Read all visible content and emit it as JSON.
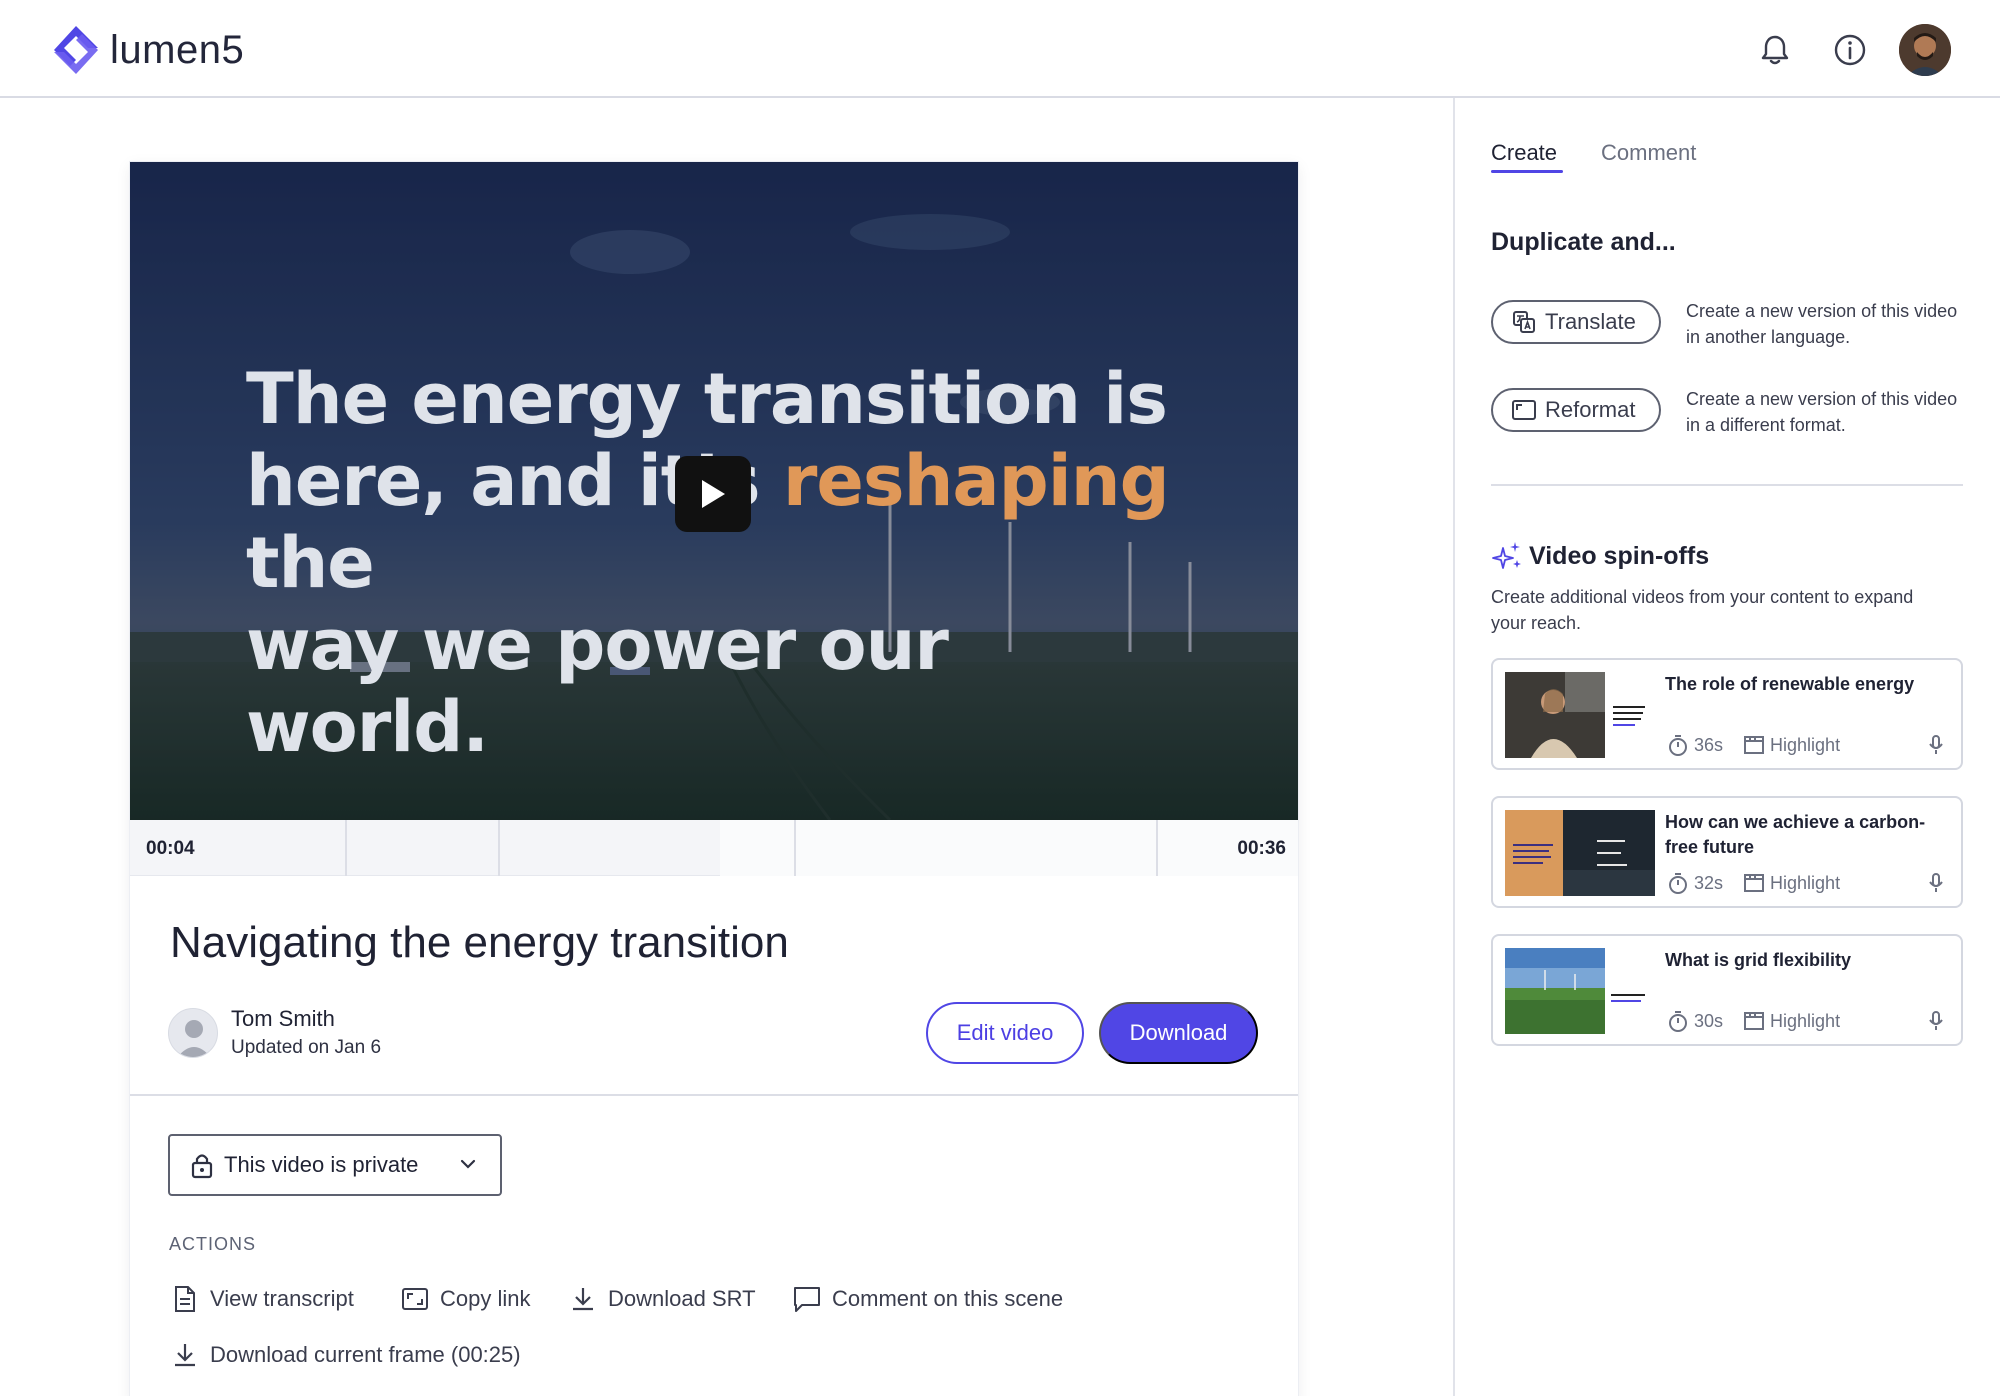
{
  "app": {
    "logo_text": "lumen5",
    "brand_color": "#5046e5",
    "header_icons": [
      "bell-icon",
      "info-icon"
    ]
  },
  "video": {
    "caption_line1": "The energy transition is",
    "caption_line2_a": "here, and it’s ",
    "caption_line2_hl": "reshaping",
    "caption_line2_b": " the",
    "caption_line3": "way we power our world.",
    "time_start": "00:04",
    "time_end": "00:36",
    "title": "Navigating the energy transition"
  },
  "author": {
    "name": "Tom Smith",
    "updated": "Updated on Jan 6"
  },
  "buttons": {
    "edit": "Edit video",
    "download": "Download"
  },
  "privacy": {
    "label": "This video is private"
  },
  "actions": {
    "heading": "ACTIONS",
    "items": [
      {
        "label": "View transcript",
        "icon": "document-icon"
      },
      {
        "label": "Copy link",
        "icon": "frame-icon"
      },
      {
        "label": "Download SRT",
        "icon": "download-icon"
      },
      {
        "label": "Comment on this scene",
        "icon": "comment-icon"
      },
      {
        "label": "Download current frame (00:25)",
        "icon": "download-icon"
      }
    ]
  },
  "sidebar": {
    "tabs": [
      {
        "label": "Create",
        "active": true
      },
      {
        "label": "Comment",
        "active": false
      }
    ],
    "duplicate_title": "Duplicate and...",
    "duplicate_options": [
      {
        "label": "Translate",
        "icon": "translate-icon",
        "desc": "Create a new version of this video in another language."
      },
      {
        "label": "Reformat",
        "icon": "reformat-icon",
        "desc": "Create a new version of this video in a different format."
      }
    ],
    "spinoffs_title": "Video spin-offs",
    "spinoffs_subtitle": "Create additional videos from your content to expand your reach.",
    "spinoffs": [
      {
        "title": "The role of renewable energy",
        "duration": "36s",
        "type": "Highlight"
      },
      {
        "title": "How can we achieve a carbon-free future",
        "duration": "32s",
        "type": "Highlight"
      },
      {
        "title": "What is grid flexibility",
        "duration": "30s",
        "type": "Highlight"
      }
    ]
  }
}
